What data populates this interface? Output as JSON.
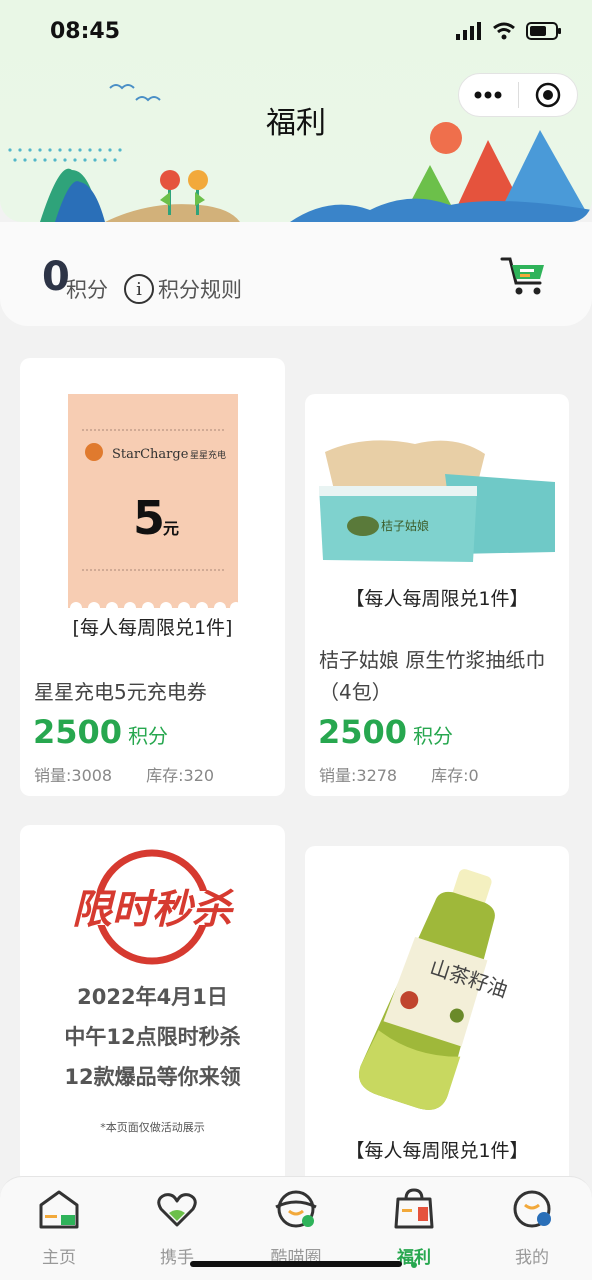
{
  "status": {
    "time": "08:45"
  },
  "header": {
    "title": "福利"
  },
  "points": {
    "value": "0",
    "unit": "积分",
    "rules_label": "积分规则"
  },
  "products": [
    {
      "name": "星星充电5元充电券",
      "limit": "[每人每周限兑1件]",
      "price": "2500",
      "price_unit": "积分",
      "sales": "销量:3008",
      "stock": "库存:320",
      "image": {
        "brand": "StarCharge",
        "brand_cn": "星星充电",
        "amount": "5",
        "amount_unit": "元"
      }
    },
    {
      "name": "桔子姑娘 原生竹浆抽纸巾（4包）",
      "limit": "【每人每周限兑1件】",
      "price": "2500",
      "price_unit": "积分",
      "sales": "销量:3278",
      "stock": "库存:0",
      "image": {
        "brand": "桔子姑娘"
      }
    },
    {
      "image": {
        "headline": "限时秒杀",
        "line1": "2022年4月1日",
        "line2": "中午12点限时秒杀",
        "line3": "12款爆品等你来领",
        "note": "*本页面仅做活动展示"
      }
    },
    {
      "limit": "【每人每周限兑1件】",
      "image": {
        "label": "山茶籽油"
      }
    }
  ],
  "tabs": [
    {
      "label": "主页",
      "icon": "home-icon"
    },
    {
      "label": "携手",
      "icon": "heart-hands-icon"
    },
    {
      "label": "酷喵圈",
      "icon": "cat-circle-icon"
    },
    {
      "label": "福利",
      "icon": "gift-bag-icon"
    },
    {
      "label": "我的",
      "icon": "profile-icon"
    }
  ],
  "colors": {
    "accent": "#27a74f",
    "header_bg": "#e9f7e6"
  }
}
